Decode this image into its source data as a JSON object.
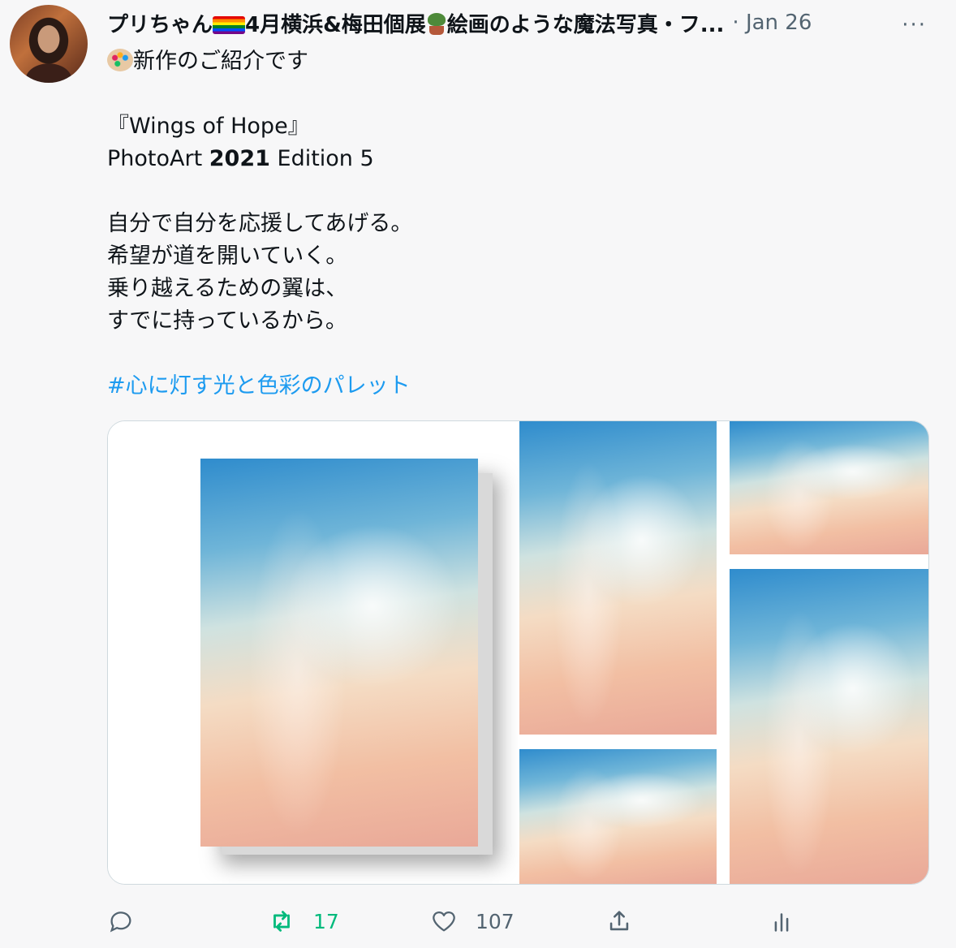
{
  "tweet": {
    "author_name": "プリちゃん",
    "author_name_rest": "4月横浜&梅田個展",
    "author_name_tail": "絵画のような魔法写真・フ...",
    "date": "· Jan 26",
    "more_label": "···",
    "intro": "新作のご紹介です",
    "title_line": "『Wings of Hope』",
    "edition_prefix": "PhotoArt ",
    "edition_year": "2021",
    "edition_suffix": " Edition 5",
    "poem": [
      "自分で自分を応援してあげる。",
      "希望が道を開いていく。",
      "乗り越えるための翼は、",
      "すでに持っているから。"
    ],
    "hashtag": "#心に灯す光と色彩のパレット"
  },
  "actions": {
    "reply_count": "",
    "retweet_count": "17",
    "like_count": "107"
  },
  "icons": {
    "reply": "reply-icon",
    "retweet": "retweet-icon",
    "like": "heart-icon",
    "share": "share-icon",
    "analytics": "analytics-icon"
  },
  "colors": {
    "accent": "#1d9bf0",
    "retweet": "#00ba7c",
    "muted": "#536471"
  }
}
